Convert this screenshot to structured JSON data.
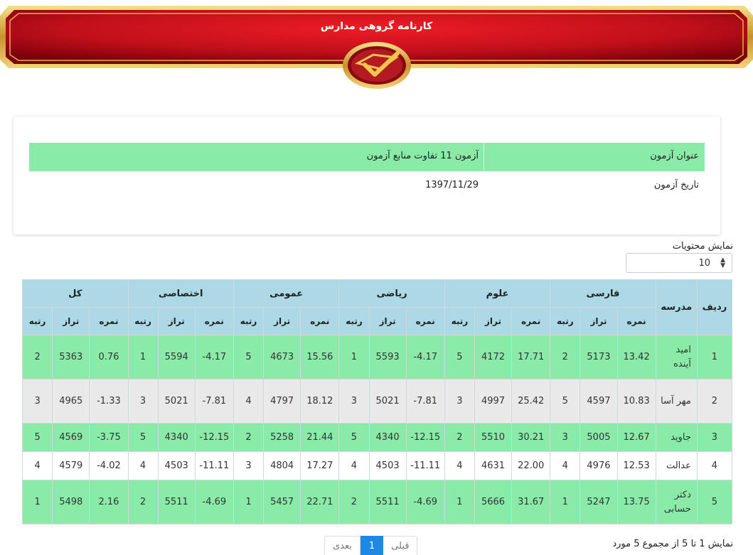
{
  "banner": {
    "title": "کارنامه گروهی مدارس"
  },
  "exam_info": {
    "title_label": "عنوان آزمون",
    "title_value": "آزمون 11 تفاوت منابع آزمون",
    "date_label": "تاریخ آزمون",
    "date_value": "1397/11/29"
  },
  "length_control": {
    "label": "نمایش محتویات",
    "selected": "10"
  },
  "table": {
    "row_header": "ردیف",
    "school_header": "مدرسه",
    "groups": [
      "فارسی",
      "علوم",
      "ریاضی",
      "عمومی",
      "اختصاصی",
      "کل"
    ],
    "sub_headers": [
      "نمره",
      "تراز",
      "رتبه"
    ],
    "rows": [
      {
        "row": "1",
        "school": "امید آینده",
        "cells": [
          "13.42",
          "5173",
          "2",
          "17.71",
          "4172",
          "5",
          "-4.17",
          "5593",
          "1",
          "15.56",
          "4673",
          "5",
          "-4.17",
          "5594",
          "1",
          "0.76",
          "5363",
          "2"
        ]
      },
      {
        "row": "2",
        "school": "مهر آسا",
        "cells": [
          "10.83",
          "4597",
          "5",
          "25.42",
          "4997",
          "3",
          "-7.81",
          "5021",
          "3",
          "18.12",
          "4797",
          "4",
          "-7.81",
          "5021",
          "3",
          "-1.33",
          "4965",
          "3"
        ]
      },
      {
        "row": "3",
        "school": "جاوید",
        "cells": [
          "12.67",
          "5005",
          "3",
          "30.21",
          "5510",
          "2",
          "-12.15",
          "4340",
          "5",
          "21.44",
          "5258",
          "2",
          "-12.15",
          "4340",
          "5",
          "-3.75",
          "4569",
          "5"
        ]
      },
      {
        "row": "4",
        "school": "عدالت",
        "cells": [
          "12.53",
          "4976",
          "4",
          "22.00",
          "4631",
          "4",
          "-11.11",
          "4503",
          "4",
          "17.27",
          "4804",
          "3",
          "-11.11",
          "4503",
          "4",
          "-4.02",
          "4579",
          "4"
        ]
      },
      {
        "row": "5",
        "school": "دکتر حسابی",
        "cells": [
          "13.75",
          "5247",
          "1",
          "31.67",
          "5666",
          "1",
          "-4.69",
          "5511",
          "2",
          "22.71",
          "5457",
          "1",
          "-4.69",
          "5511",
          "2",
          "2.16",
          "5498",
          "1"
        ]
      }
    ]
  },
  "footer": {
    "info": "نمایش 1 تا 5 از مجموع 5 مورد",
    "pager": {
      "prev": "قبلی",
      "current": "1",
      "next": "بعدی"
    }
  },
  "colors": {
    "banner_red": "#c8101e",
    "gold": "#d9a93f",
    "header_blue": "#add8e6",
    "row_green": "#8aeaa8",
    "row_gray": "#e9e9e9",
    "pager_active": "#1e88e5"
  }
}
